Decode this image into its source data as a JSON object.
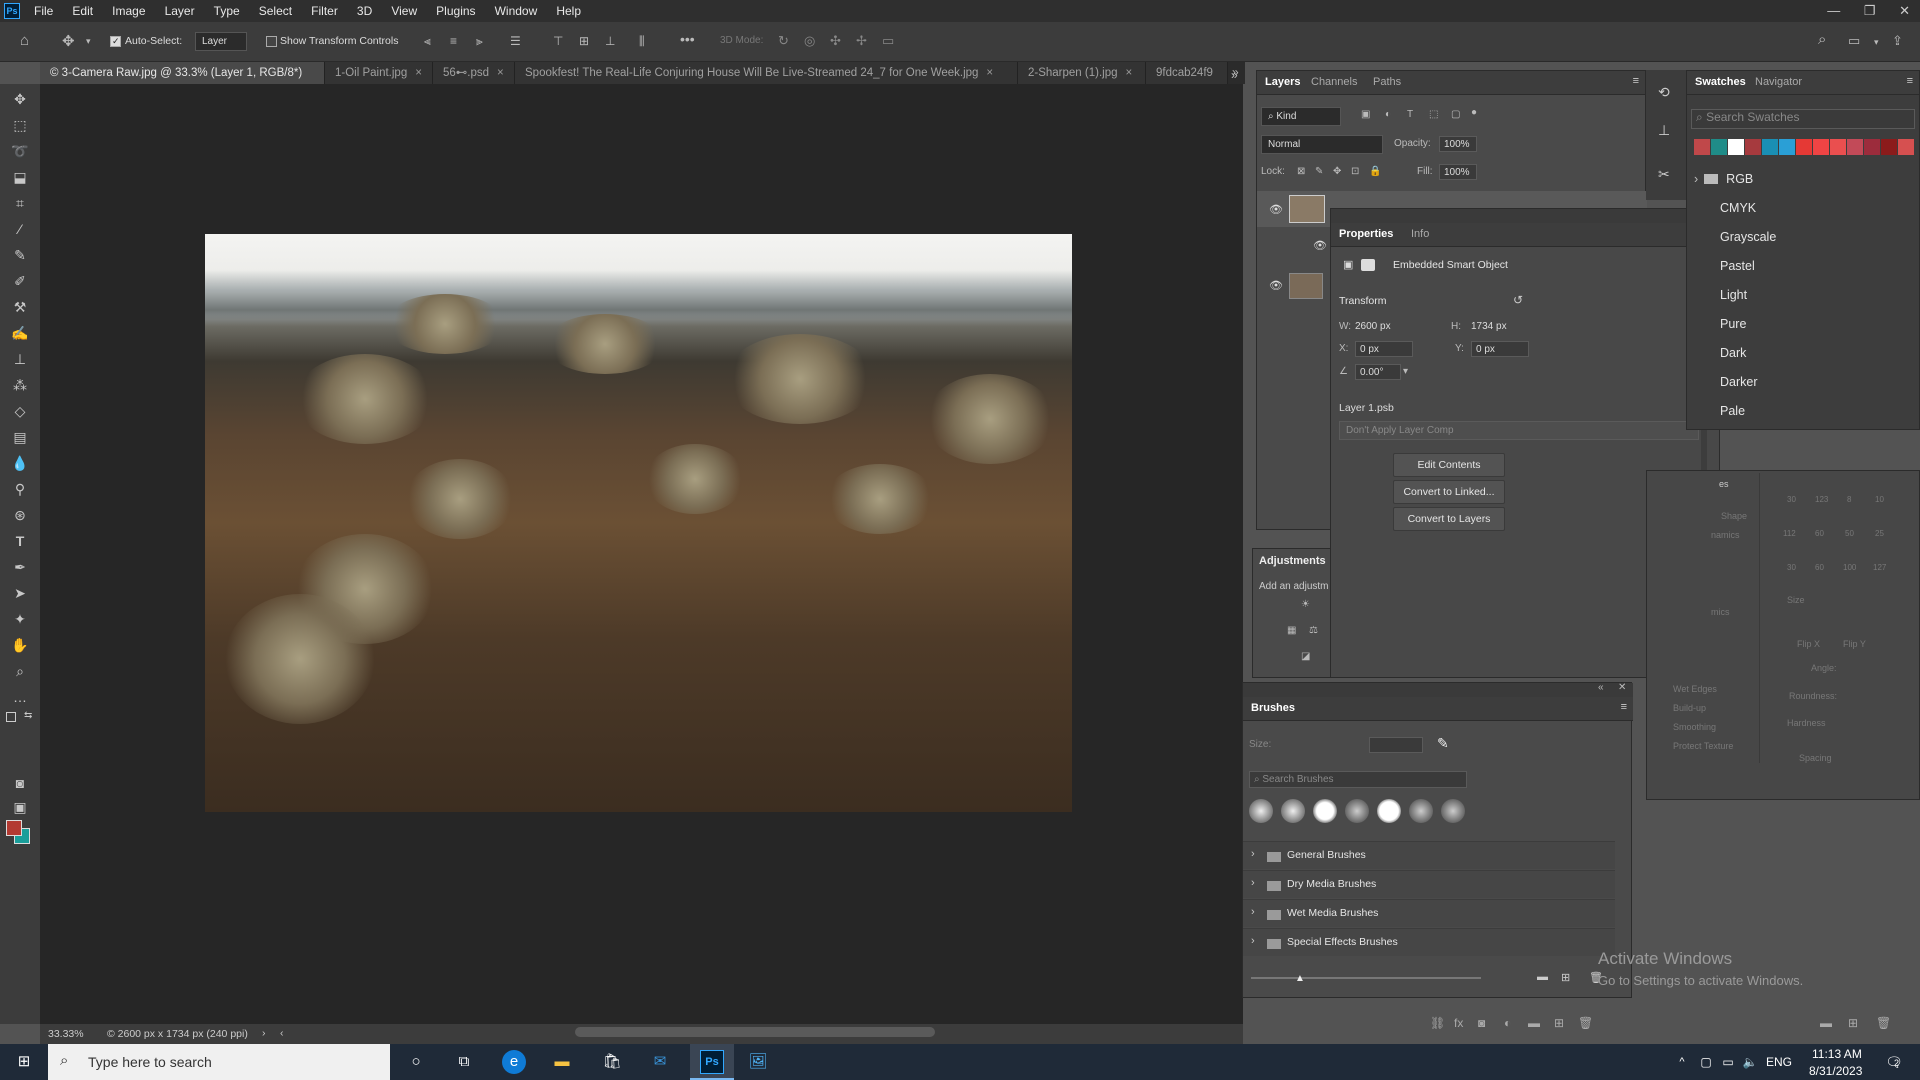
{
  "menubar": {
    "logo": "Ps",
    "items": [
      "File",
      "Edit",
      "Image",
      "Layer",
      "Type",
      "Select",
      "Filter",
      "3D",
      "View",
      "Plugins",
      "Window",
      "Help"
    ]
  },
  "options": {
    "autoselect_label": "Auto-Select:",
    "autoselect_target": "Layer",
    "show_transform": "Show Transform Controls",
    "mode_label": "3D Mode:"
  },
  "tabs": [
    {
      "label": "© 3-Camera Raw.jpg @ 33.3% (Layer 1, RGB/8*) *",
      "active": true
    },
    {
      "label": "1-Oil Paint.jpg"
    },
    {
      "label": "56⊷.psd"
    },
    {
      "label": "Spookfest! The Real-Life Conjuring House Will Be Live-Streamed 24_7 for One Week.jpg"
    },
    {
      "label": "2-Sharpen (1).jpg"
    },
    {
      "label": "9fdcab24f9"
    }
  ],
  "status": {
    "zoom": "33.33%",
    "doc": "© 2600 px x 1734 px (240 ppi)"
  },
  "layers": {
    "tabs": [
      "Layers",
      "Channels",
      "Paths"
    ],
    "kind": "Kind",
    "blend": "Normal",
    "opacity_label": "Opacity:",
    "opacity": "100%",
    "lock_label": "Lock:",
    "fill_label": "Fill:",
    "fill": "100%"
  },
  "properties": {
    "tabs": [
      "Properties",
      "Info"
    ],
    "type": "Embedded Smart Object",
    "transform_label": "Transform",
    "w_label": "W:",
    "w": "2600 px",
    "h_label": "H:",
    "h": "1734 px",
    "x_label": "X:",
    "x": "0 px",
    "y_label": "Y:",
    "y": "0 px",
    "angle": "0.00°",
    "file": "Layer 1.psb",
    "layer_comp": "Don't Apply Layer Comp",
    "buttons": [
      "Edit Contents",
      "Convert to Linked...",
      "Convert to Layers"
    ]
  },
  "adjustments": {
    "title": "Adjustments",
    "hint": "Add an adjustm"
  },
  "swatches": {
    "tabs": [
      "Swatches",
      "Navigator"
    ],
    "search_placeholder": "Search Swatches",
    "colors": [
      "#c0484a",
      "#1f8c88",
      "#ffffff",
      "#a63a3e",
      "#1a8fb4",
      "#2a9fd6",
      "#e53935",
      "#ef4444",
      "#ea4f4f",
      "#c24a58",
      "#9c2c3c",
      "#8b1b1b",
      "#d65050"
    ],
    "groups": [
      "RGB",
      "CMYK",
      "Grayscale",
      "Pastel",
      "Light",
      "Pure",
      "Dark",
      "Darker",
      "Pale"
    ]
  },
  "brush_settings": {
    "items": [
      "Shape",
      "namics",
      "",
      "",
      "mics",
      "",
      "",
      "Wet Edges",
      "Build-up",
      "Smoothing",
      "Protect Texture"
    ],
    "tips": [
      "30",
      "123",
      "8",
      "10",
      "112",
      "60",
      "50",
      "25",
      "30",
      "60",
      "100",
      "127"
    ],
    "size": "Size",
    "flip_x": "Flip X",
    "flip_y": "Flip Y",
    "angle": "Angle:",
    "roundness": "Roundness:",
    "hardness": "Hardness",
    "spacing": "Spacing",
    "tab_label": "es"
  },
  "brushes": {
    "title": "Brushes",
    "size_label": "Size:",
    "search_placeholder": "Search Brushes",
    "folders": [
      "General Brushes",
      "Dry Media Brushes",
      "Wet Media Brushes",
      "Special Effects Brushes"
    ]
  },
  "watermark": {
    "title": "Activate Windows",
    "sub": "Go to Settings to activate Windows."
  },
  "taskbar": {
    "search_placeholder": "Type here to search",
    "lang": "ENG",
    "time": "11:13 AM",
    "date": "8/31/2023",
    "notif": "2"
  }
}
